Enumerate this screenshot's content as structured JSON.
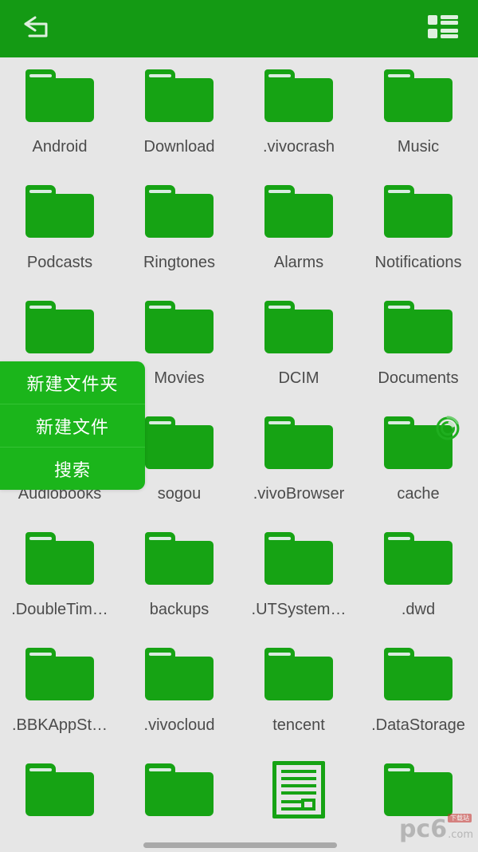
{
  "theme": {
    "header_green": "#149a14",
    "icon_green": "#16a314",
    "menu_green": "#1bb51b",
    "background": "#e6e6e6",
    "label_color": "#4b4b4b"
  },
  "topbar": {
    "back_label": "back-arrow",
    "view_toggle_label": "list-view"
  },
  "context_menu": {
    "items": [
      {
        "label": "新建文件夹"
      },
      {
        "label": "新建文件"
      },
      {
        "label": "搜索"
      }
    ]
  },
  "status": {
    "loading_indicator": "loading-spinner"
  },
  "watermark": {
    "main": "pc6",
    "domain": ".com",
    "badge": "下载站"
  },
  "file_grid": {
    "columns": 4,
    "items": [
      {
        "name": "Android",
        "type": "folder"
      },
      {
        "name": "Download",
        "type": "folder"
      },
      {
        "name": ".vivocrash",
        "type": "folder"
      },
      {
        "name": "Music",
        "type": "folder"
      },
      {
        "name": "Podcasts",
        "type": "folder"
      },
      {
        "name": "Ringtones",
        "type": "folder"
      },
      {
        "name": "Alarms",
        "type": "folder"
      },
      {
        "name": "Notifications",
        "type": "folder"
      },
      {
        "name": "",
        "type": "folder"
      },
      {
        "name": "Movies",
        "type": "folder"
      },
      {
        "name": "DCIM",
        "type": "folder"
      },
      {
        "name": "Documents",
        "type": "folder"
      },
      {
        "name": "Audiobooks",
        "type": "folder"
      },
      {
        "name": "sogou",
        "type": "folder"
      },
      {
        "name": ".vivoBrowser",
        "type": "folder"
      },
      {
        "name": "cache",
        "type": "folder"
      },
      {
        "name": ".DoubleTim…",
        "type": "folder"
      },
      {
        "name": "backups",
        "type": "folder"
      },
      {
        "name": ".UTSystem…",
        "type": "folder"
      },
      {
        "name": ".dwd",
        "type": "folder"
      },
      {
        "name": ".BBKAppSt…",
        "type": "folder"
      },
      {
        "name": ".vivocloud",
        "type": "folder"
      },
      {
        "name": "tencent",
        "type": "folder"
      },
      {
        "name": ".DataStorage",
        "type": "folder"
      },
      {
        "name": "",
        "type": "folder"
      },
      {
        "name": "",
        "type": "folder"
      },
      {
        "name": "",
        "type": "document"
      },
      {
        "name": "",
        "type": "folder"
      }
    ]
  }
}
